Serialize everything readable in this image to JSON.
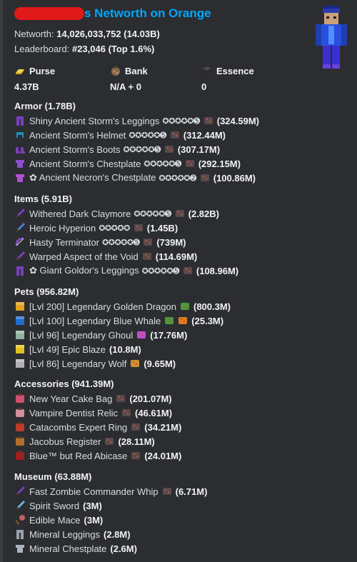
{
  "header": {
    "title": "s Networth on Orange",
    "networth_label": "Networth:",
    "networth_value": "14,026,033,752 (14.03B)",
    "leaderboard_label": "Leaderboard:",
    "leaderboard_value": "#23,046 (Top 1.6%)"
  },
  "stats": {
    "purse": {
      "label": "Purse",
      "value": "4.37B"
    },
    "bank": {
      "label": "Bank",
      "value": "N/A + 0"
    },
    "essence": {
      "label": "Essence",
      "value": "0"
    }
  },
  "sections": {
    "armor": {
      "title": "Armor (1.78B)",
      "items": [
        {
          "name": "Shiny Ancient Storm's Leggings",
          "stars": "✪✪✪✪✪➎",
          "value": "(324.59M)",
          "icon": "leggings-icon",
          "color": "#7b3fbf"
        },
        {
          "name": "Ancient Storm's Helmet",
          "stars": "✪✪✪✪✪➎",
          "value": "(312.44M)",
          "icon": "helmet-icon",
          "color": "#1f8fb3"
        },
        {
          "name": "Ancient Storm's Boots",
          "stars": "✪✪✪✪✪➎",
          "value": "(307.17M)",
          "icon": "boots-icon",
          "color": "#7b3fbf"
        },
        {
          "name": "Ancient Storm's Chestplate",
          "stars": "✪✪✪✪✪➎",
          "value": "(292.15M)",
          "icon": "chestplate-icon",
          "color": "#8a4fd1"
        },
        {
          "name": "✿ Ancient Necron's Chestplate",
          "stars": "✪✪✪✪✪➋",
          "value": "(100.86M)",
          "icon": "chestplate-icon",
          "color": "#b14fd1"
        }
      ]
    },
    "items": {
      "title": "Items (5.91B)",
      "items": [
        {
          "name": "Withered Dark Claymore",
          "stars": "✪✪✪✪✪➎",
          "value": "(2.82B)",
          "icon": "sword-icon",
          "color": "#7b3fbf"
        },
        {
          "name": "Heroic Hyperion",
          "stars": "✪✪✪✪✪",
          "value": "(1.45B)",
          "icon": "sword-icon",
          "color": "#4f7bd1"
        },
        {
          "name": "Hasty Terminator",
          "stars": "✪✪✪✪✪➎",
          "value": "(739M)",
          "icon": "bow-icon",
          "color": "#8a4fd1"
        },
        {
          "name": "Warped Aspect of the Void",
          "stars": "",
          "value": "(114.69M)",
          "icon": "sword-icon",
          "color": "#7b3fbf"
        },
        {
          "name": "✿ Giant Goldor's Leggings",
          "stars": "✪✪✪✪✪➎",
          "value": "(108.96M)",
          "icon": "leggings-icon",
          "color": "#7b3fbf"
        }
      ]
    },
    "pets": {
      "title": "Pets (956.82M)",
      "items": [
        {
          "name": "[Lvl 200] Legendary Golden Dragon",
          "value": "(800.3M)",
          "icon": "dragon-icon",
          "color": "#e0a21f",
          "extra": "green-block"
        },
        {
          "name": "[Lvl 100] Legendary Blue Whale",
          "value": "(25.3M)",
          "icon": "whale-icon",
          "color": "#1f6fd1",
          "extra": "carrot"
        },
        {
          "name": "[Lvl 96] Legendary Ghoul",
          "value": "(17.76M)",
          "icon": "ghoul-icon",
          "color": "#8fb3a0",
          "extra": "sword"
        },
        {
          "name": "[Lvl 49] Epic Blaze",
          "value": "(10.8M)",
          "icon": "blaze-icon",
          "color": "#e0c21f",
          "extra": ""
        },
        {
          "name": "[Lvl 86] Legendary Wolf",
          "value": "(9.65M)",
          "icon": "wolf-icon",
          "color": "#b0b0b0",
          "extra": "bone"
        }
      ]
    },
    "accessories": {
      "title": "Accessories (941.39M)",
      "items": [
        {
          "name": "New Year Cake Bag",
          "value": "(201.07M)",
          "icon": "cake-bag-icon",
          "color": "#d14f6f"
        },
        {
          "name": "Vampire Dentist Relic",
          "value": "(46.61M)",
          "icon": "relic-icon",
          "color": "#d18fa0"
        },
        {
          "name": "Catacombs Expert Ring",
          "value": "(34.21M)",
          "icon": "ring-icon",
          "color": "#c0392b"
        },
        {
          "name": "Jacobus Register",
          "value": "(28.11M)",
          "icon": "register-icon",
          "color": "#b0702b"
        },
        {
          "name": "Blue™ but Red Abicase",
          "value": "(24.01M)",
          "icon": "abicase-icon",
          "color": "#a02020"
        }
      ]
    },
    "museum": {
      "title": "Museum (63.88M)",
      "items": [
        {
          "name": "Fast Zombie Commander Whip",
          "value": "(6.71M)",
          "icon": "whip-icon",
          "color": "#7b3fbf",
          "chip": true
        },
        {
          "name": "Spirit Sword",
          "value": "(3M)",
          "icon": "sword-icon",
          "color": "#6fb3e0",
          "chip": false
        },
        {
          "name": "Edible Mace",
          "value": "(3M)",
          "icon": "mace-icon",
          "color": "#c06060",
          "chip": false
        },
        {
          "name": "Mineral Leggings",
          "value": "(2.8M)",
          "icon": "leggings-icon",
          "color": "#9aa3ad",
          "chip": false
        },
        {
          "name": "Mineral Chestplate",
          "value": "(2.6M)",
          "icon": "chestplate-icon",
          "color": "#aab3bd",
          "chip": false
        }
      ]
    }
  },
  "colors": {
    "background": "#2b2d31",
    "title": "#00a8fc",
    "redaction": "#e01919",
    "text": "#dbdee1",
    "bold": "#f2f3f5"
  }
}
